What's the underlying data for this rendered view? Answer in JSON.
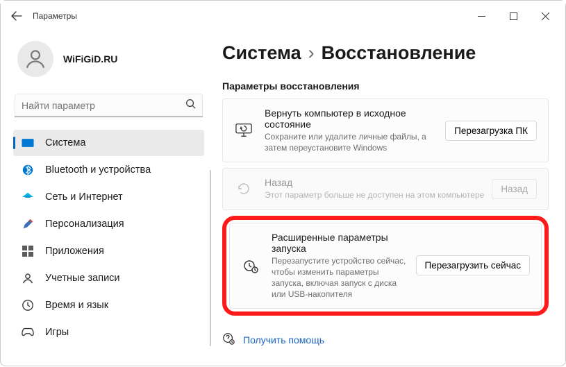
{
  "titlebar": {
    "title": "Параметры"
  },
  "profile": {
    "name": "WiFiGiD.RU"
  },
  "search": {
    "placeholder": "Найти параметр"
  },
  "nav": {
    "items": [
      {
        "label": "Система"
      },
      {
        "label": "Bluetooth и устройства"
      },
      {
        "label": "Сеть и Интернет"
      },
      {
        "label": "Персонализация"
      },
      {
        "label": "Приложения"
      },
      {
        "label": "Учетные записи"
      },
      {
        "label": "Время и язык"
      },
      {
        "label": "Игры"
      }
    ]
  },
  "breadcrumb": {
    "parent": "Система",
    "current": "Восстановление"
  },
  "section": {
    "title": "Параметры восстановления"
  },
  "cards": {
    "reset": {
      "title": "Вернуть компьютер в исходное состояние",
      "desc": "Сохраните или удалите личные файлы, а затем переустановите Windows",
      "button": "Перезагрузка ПК"
    },
    "previous": {
      "title": "Назад",
      "desc": "Этот параметр больше не доступен на этом компьютере",
      "button": "Назад"
    },
    "advanced": {
      "title": "Расширенные параметры запуска",
      "desc": "Перезапустите устройство сейчас, чтобы изменить параметры запуска, включая запуск с диска или USB-накопителя",
      "button": "Перезагрузить сейчас"
    }
  },
  "help": {
    "label": "Получить помощь"
  }
}
